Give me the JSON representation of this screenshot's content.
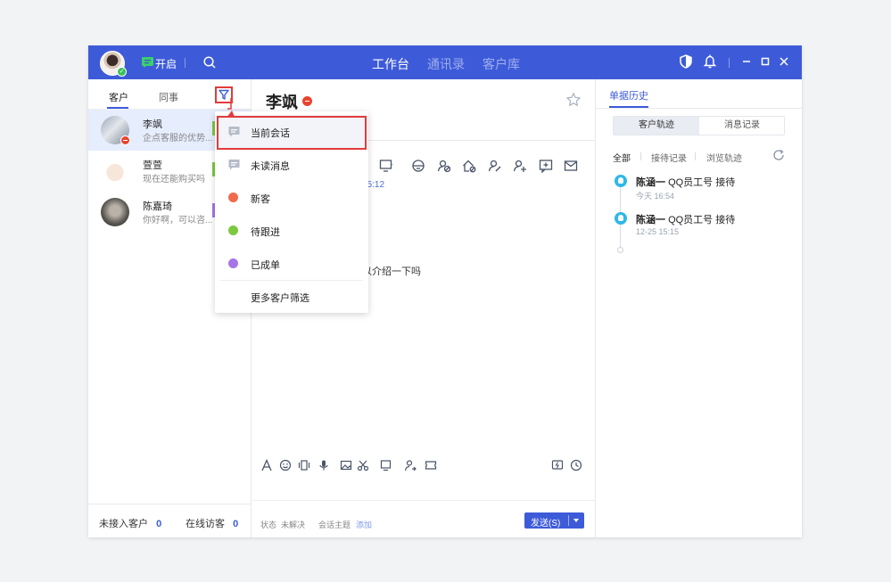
{
  "titlebar": {
    "status_label": "开启",
    "nav_tabs": [
      "工作台",
      "通讯录",
      "客户库"
    ],
    "active_tab": "工作台",
    "bg_color": "#3d5bd9"
  },
  "left_panel": {
    "tabs": [
      "客户",
      "同事"
    ],
    "contacts": [
      {
        "name": "李飒",
        "message": "企点客服的优势..."
      },
      {
        "name": "萱萱",
        "message": "现在还能购买吗"
      },
      {
        "name": "陈嘉琦",
        "message": "你好啊，可以咨..."
      }
    ],
    "footer": {
      "unassigned_label": "未接入客户",
      "unassigned_count": "0",
      "online_label": "在线访客",
      "online_count": "0"
    }
  },
  "chat": {
    "contact_name": "李飒",
    "message_time": "15:12",
    "message_text": "以介绍一下吗",
    "footer": {
      "status_label": "状态",
      "status_value": "未解决",
      "topic_label": "会话主题",
      "topic_add": "添加",
      "send_label": "发送(S)"
    }
  },
  "filter_menu": {
    "items": [
      {
        "label": "当前会话",
        "icon": "chat-icon"
      },
      {
        "label": "未读消息",
        "icon": "unread-message-icon"
      },
      {
        "label": "新客",
        "dot_color": "#f06a4e"
      },
      {
        "label": "待跟进",
        "dot_color": "#7cc940"
      },
      {
        "label": "已成单",
        "dot_color": "#a675e8"
      }
    ],
    "more_label": "更多客户筛选"
  },
  "right_panel": {
    "title": "单据历史",
    "segments": [
      "客户轨迹",
      "消息记录"
    ],
    "filters": [
      "全部",
      "接待记录",
      "浏览轨迹"
    ],
    "timeline": [
      {
        "agent": "陈涵一",
        "desc": "QQ员工号 接待",
        "time": "今天 16:54"
      },
      {
        "agent": "陈涵一",
        "desc": "QQ员工号 接待",
        "time": "12-25 15:15"
      }
    ]
  }
}
